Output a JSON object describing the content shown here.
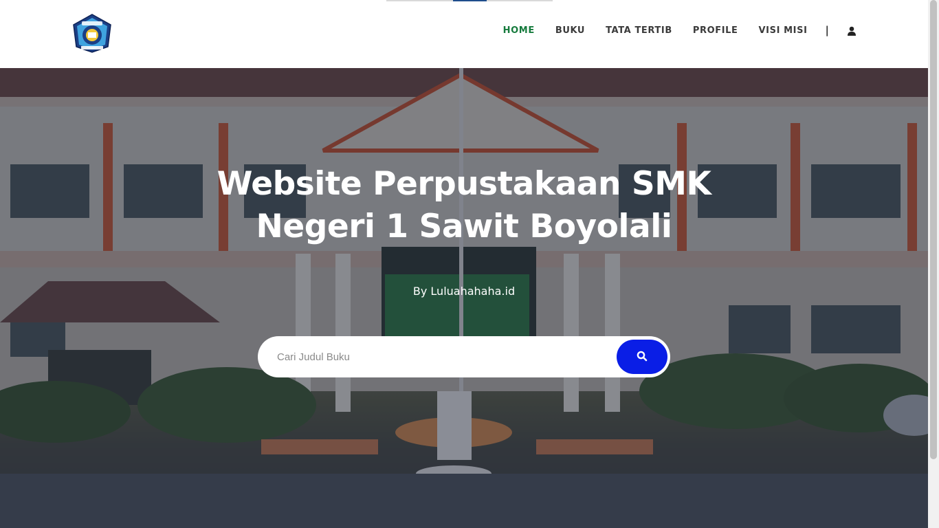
{
  "header": {
    "logo_name": "smk-negeri-1-sawit-logo",
    "nav": [
      {
        "label": "HOME",
        "active": true
      },
      {
        "label": "BUKU",
        "active": false
      },
      {
        "label": "TATA TERTIB",
        "active": false
      },
      {
        "label": "PROFILE",
        "active": false
      },
      {
        "label": "VISI MISI",
        "active": false
      }
    ],
    "separator": "|",
    "user_icon": "user-icon"
  },
  "hero": {
    "title_line1": "Website Perpustakaan SMK",
    "title_line2": "Negeri 1 Sawit Boyolali",
    "by_line": "By  Luluahahaha.id",
    "background": "school-building-photo"
  },
  "search": {
    "placeholder": "Cari Judul Buku",
    "button_icon": "search-icon",
    "button_color": "#0a1ee6"
  },
  "colors": {
    "active_nav": "#157a3c",
    "nav_text": "#3a3a3a"
  }
}
